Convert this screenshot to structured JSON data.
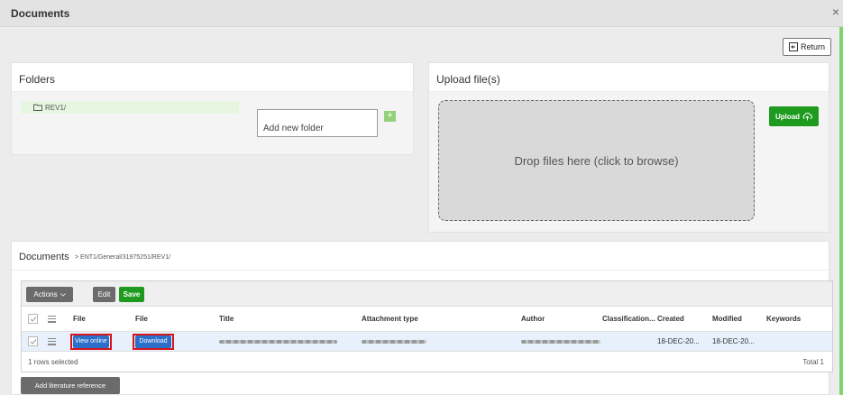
{
  "window": {
    "title": "Documents",
    "close_glyph": "×"
  },
  "header": {
    "return_label": "Return",
    "return_icon": "exit-icon"
  },
  "folders": {
    "title": "Folders",
    "items": [
      {
        "label": "REV1/",
        "icon": "folder-icon"
      }
    ],
    "new_folder_placeholder": "Add new folder",
    "add_glyph": "+"
  },
  "upload": {
    "title": "Upload file(s)",
    "dropzone_text": "Drop files here (click to browse)",
    "upload_label": "Upload",
    "upload_icon": "cloud-upload-icon"
  },
  "documents": {
    "title": "Documents",
    "path": "> ENT1/General/31975251/REV1/",
    "toolbar": {
      "actions_label": "Actions",
      "edit_label": "Edit",
      "save_label": "Save"
    },
    "columns": [
      "File",
      "File",
      "Title",
      "Attachment type",
      "Author",
      "Classification...",
      "Created",
      "Modified",
      "Keywords"
    ],
    "rows": [
      {
        "view_online_label": "View online",
        "download_label": "Download",
        "classification": "",
        "created": "18-DEC-20...",
        "modified": "18-DEC-20...",
        "keywords": ""
      }
    ],
    "selected_text": "1 rows selected",
    "total_text": "Total 1",
    "add_reference_label": "Add literature reference"
  },
  "colors": {
    "accent_green": "#1e9a1e",
    "button_blue": "#2b6fc9",
    "highlight_red": "#d8141b",
    "selection_row": "#e7f0fb",
    "folder_selected": "#e7f6e0"
  }
}
